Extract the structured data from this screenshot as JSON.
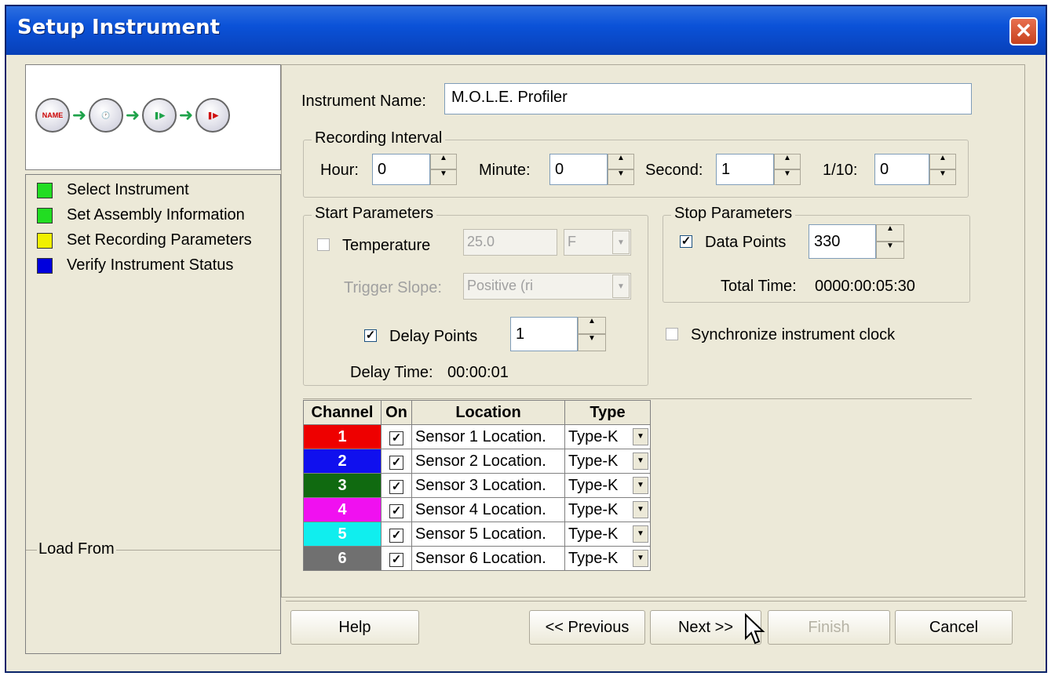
{
  "window": {
    "title": "Setup Instrument",
    "close_label": "✕"
  },
  "wizard_icons": [
    {
      "name": "name-step-icon",
      "text": "NAME"
    },
    {
      "name": "clock-step-icon",
      "text": "🕐"
    },
    {
      "name": "start-step-icon",
      "text": "❚▶"
    },
    {
      "name": "stop-step-icon",
      "text": "❚▶"
    }
  ],
  "steps": [
    {
      "label": "Select Instrument",
      "color": "#22dd22"
    },
    {
      "label": "Set Assembly Information",
      "color": "#22dd22"
    },
    {
      "label": "Set Recording Parameters",
      "color": "#f0f000"
    },
    {
      "label": "Verify Instrument Status",
      "color": "#0000dd"
    }
  ],
  "load_from": "Load From",
  "instrument": {
    "label": "Instrument Name:",
    "value": "M.O.L.E. Profiler"
  },
  "recording_interval": {
    "title": "Recording Interval",
    "hour_label": "Hour:",
    "hour": "0",
    "minute_label": "Minute:",
    "minute": "0",
    "second_label": "Second:",
    "second": "1",
    "tenth_label": "1/10:",
    "tenth": "0"
  },
  "start": {
    "title": "Start Parameters",
    "temperature_label": "Temperature",
    "temperature_value": "25.0",
    "temperature_unit": "F",
    "trigger_label": "Trigger Slope:",
    "trigger_value": "Positive (ri",
    "delay_points_label": "Delay Points",
    "delay_points": "1",
    "delay_time_label": "Delay Time:",
    "delay_time": "00:00:01"
  },
  "stop": {
    "title": "Stop Parameters",
    "data_points_label": "Data Points",
    "data_points": "330",
    "total_time_label": "Total Time:",
    "total_time": "0000:00:05:30"
  },
  "sync_label": "Synchronize instrument clock",
  "grid": {
    "headers": [
      "Channel",
      "On",
      "Location",
      "Type"
    ],
    "rows": [
      {
        "channel": "1",
        "color": "#ee0000",
        "on": "✓",
        "location": "Sensor 1 Location.",
        "type": "Type-K"
      },
      {
        "channel": "2",
        "color": "#1010ee",
        "on": "✓",
        "location": "Sensor 2 Location.",
        "type": "Type-K"
      },
      {
        "channel": "3",
        "color": "#106a10",
        "on": "✓",
        "location": "Sensor 3 Location.",
        "type": "Type-K"
      },
      {
        "channel": "4",
        "color": "#f010f0",
        "on": "✓",
        "location": "Sensor 4 Location.",
        "type": "Type-K"
      },
      {
        "channel": "5",
        "color": "#10eeee",
        "on": "✓",
        "location": "Sensor 5 Location.",
        "type": "Type-K"
      },
      {
        "channel": "6",
        "color": "#707070",
        "on": "✓",
        "location": "Sensor 6 Location.",
        "type": "Type-K"
      }
    ]
  },
  "buttons": {
    "help": "Help",
    "previous": "<< Previous",
    "next": "Next >>",
    "finish": "Finish",
    "cancel": "Cancel"
  }
}
